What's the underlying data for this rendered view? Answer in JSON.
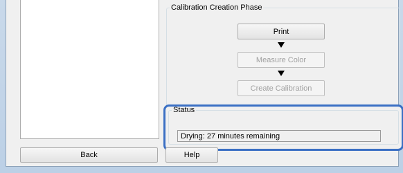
{
  "phase_group": {
    "title": "Calibration Creation Phase",
    "steps": [
      {
        "label": "Print",
        "enabled": true
      },
      {
        "label": "Measure Color",
        "enabled": false
      },
      {
        "label": "Create Calibration",
        "enabled": false
      }
    ]
  },
  "status_group": {
    "title": "Status",
    "message": "Drying: 27 minutes remaining"
  },
  "buttons": {
    "back": "Back",
    "help": "Help"
  },
  "colors": {
    "highlight_border": "#3a6fc4",
    "disabled_text": "#a0a0a0"
  }
}
